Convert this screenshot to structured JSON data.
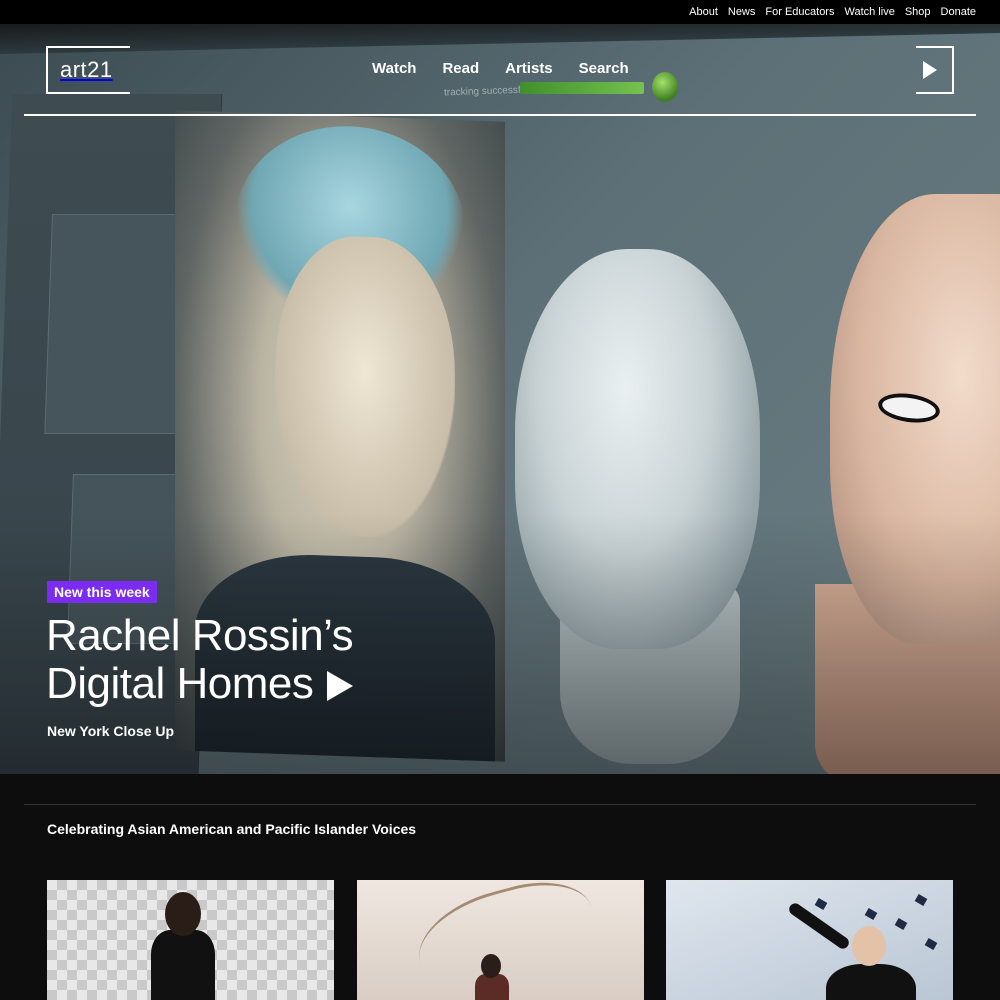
{
  "utility_nav": [
    "About",
    "News",
    "For Educators",
    "Watch live",
    "Shop",
    "Donate"
  ],
  "logo": {
    "text": "art21"
  },
  "main_nav": [
    "Watch",
    "Read",
    "Artists",
    "Search"
  ],
  "hero": {
    "badge": "New this week",
    "title_line1": "Rachel Rossin’s",
    "title_line2": "Digital Homes",
    "subtitle": "New York Close Up",
    "image_text": "tracking successful"
  },
  "section": {
    "title": "Celebrating Asian American and Pacific Islander Voices"
  },
  "colors": {
    "badge": "#7c2cf0",
    "background": "#0d0d0d"
  }
}
